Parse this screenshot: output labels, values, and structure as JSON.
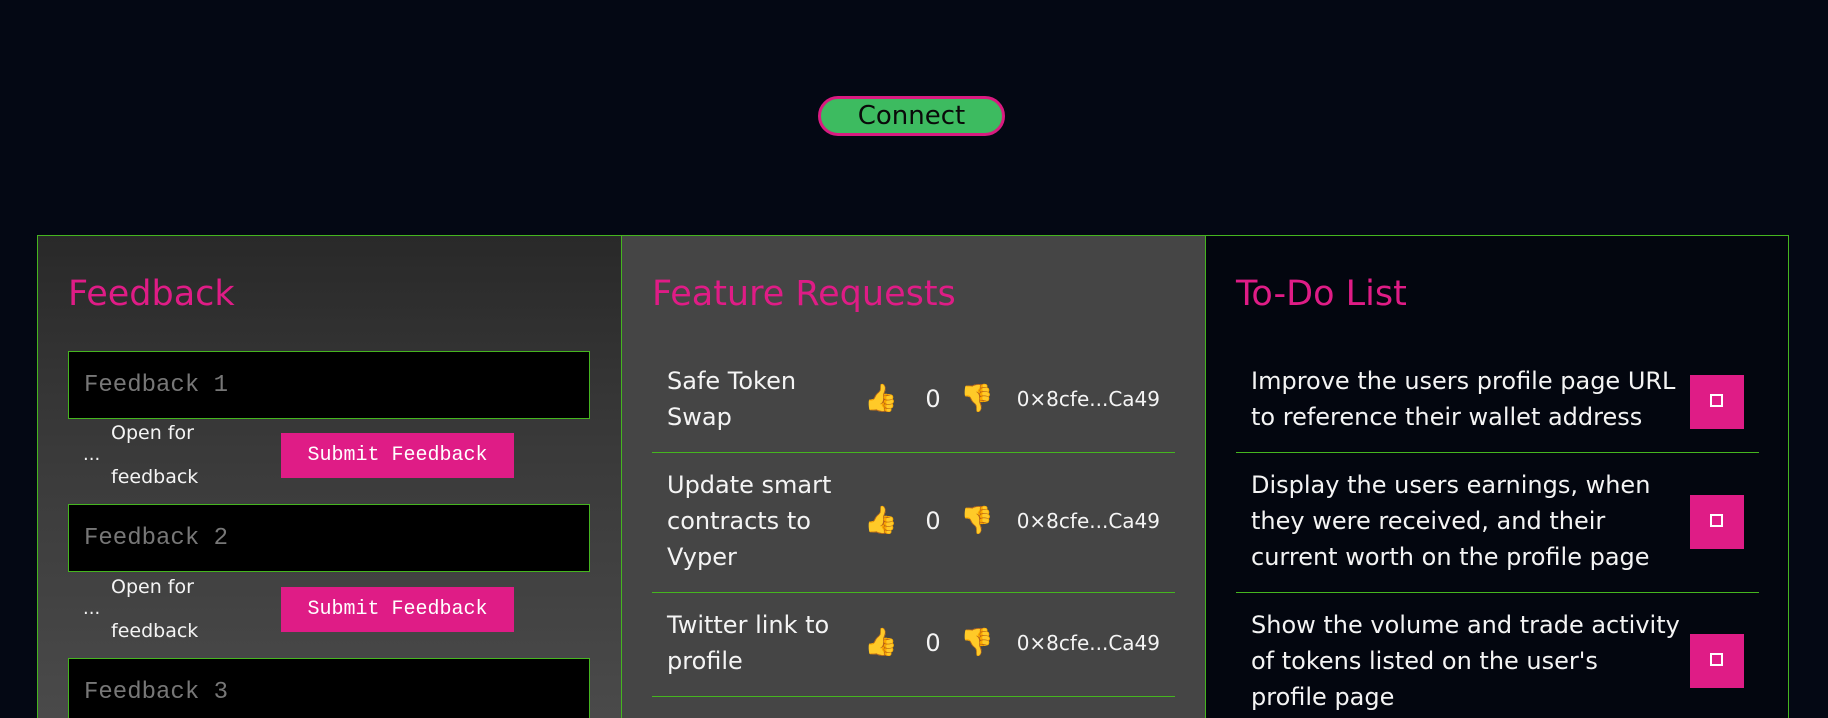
{
  "header": {
    "connect_label": "Connect"
  },
  "feedback": {
    "title": "Feedback",
    "items": [
      {
        "placeholder": "Feedback 1",
        "dots": "...",
        "status": "Open for feedback",
        "button": "Submit Feedback"
      },
      {
        "placeholder": "Feedback 2",
        "dots": "...",
        "status": "Open for feedback",
        "button": "Submit Feedback"
      },
      {
        "placeholder": "Feedback 3"
      }
    ]
  },
  "features": {
    "title": "Feature Requests",
    "items": [
      {
        "title": "Safe Token Swap",
        "votes": "0",
        "address": "0×8cfe...Ca49",
        "up_icon": "👍",
        "down_icon": "👎"
      },
      {
        "title": "Update smart contracts to Vyper",
        "votes": "0",
        "address": "0×8cfe...Ca49",
        "up_icon": "👍",
        "down_icon": "👎"
      },
      {
        "title": "Twitter link to profile",
        "votes": "0",
        "address": "0×8cfe...Ca49",
        "up_icon": "👍",
        "down_icon": "👎"
      }
    ]
  },
  "todo": {
    "title": "To-Do List",
    "items": [
      {
        "text": "Improve the users profile page URL to reference their wallet address"
      },
      {
        "text": "Display the users earnings, when they were received, and their current worth on the profile page"
      },
      {
        "text": "Show the volume and trade activity of tokens listed on the user's profile page"
      }
    ]
  },
  "colors": {
    "accent": "#df1c86",
    "connect": "#3dbb60",
    "border": "#45b51f",
    "background": "#040814"
  }
}
